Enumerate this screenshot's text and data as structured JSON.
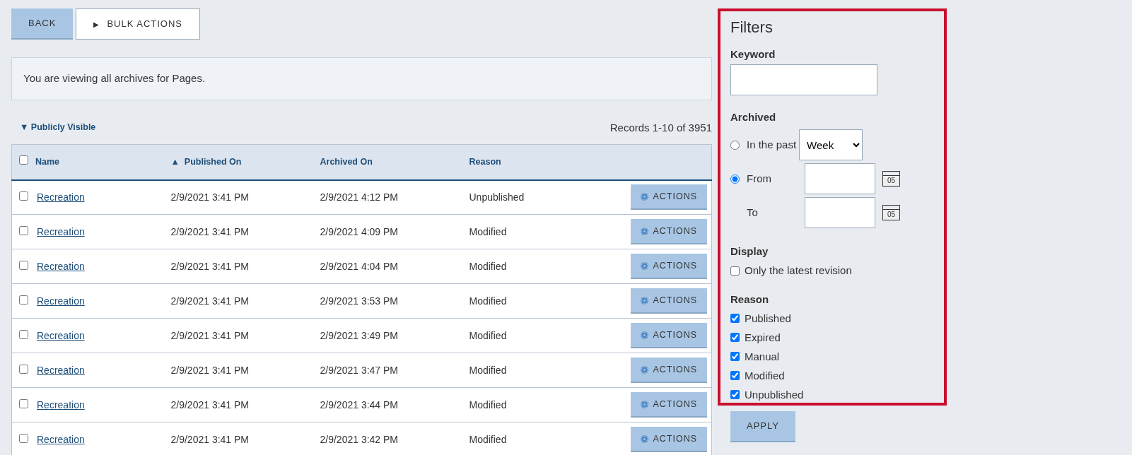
{
  "toolbar": {
    "buttons": [
      {
        "label": "BACK",
        "kind": "primary"
      },
      {
        "label": "BULK ACTIONS",
        "kind": "outline",
        "icon_text": "▶"
      }
    ]
  },
  "notice": "You are viewing all archives for Pages.",
  "group_toggle": {
    "icon_text": "▼",
    "label": "Publicly Visible"
  },
  "records": "Records 1-10 of 3951",
  "table": {
    "select_all_checked": false,
    "columns": [
      {
        "label": "Name"
      },
      {
        "label": "Published On",
        "sort_icon": "▲"
      },
      {
        "label": "Archived On"
      },
      {
        "label": "Reason"
      }
    ],
    "rows": [
      {
        "checked": false,
        "name": "Recreation",
        "published_on": "2/9/2021 3:41 PM",
        "archived_on": "2/9/2021 4:12 PM",
        "reason": "Unpublished",
        "action": "ACTIONS"
      },
      {
        "checked": false,
        "name": "Recreation",
        "published_on": "2/9/2021 3:41 PM",
        "archived_on": "2/9/2021 4:09 PM",
        "reason": "Modified",
        "action": "ACTIONS"
      },
      {
        "checked": false,
        "name": "Recreation",
        "published_on": "2/9/2021 3:41 PM",
        "archived_on": "2/9/2021 4:04 PM",
        "reason": "Modified",
        "action": "ACTIONS"
      },
      {
        "checked": false,
        "name": "Recreation",
        "published_on": "2/9/2021 3:41 PM",
        "archived_on": "2/9/2021 3:53 PM",
        "reason": "Modified",
        "action": "ACTIONS"
      },
      {
        "checked": false,
        "name": "Recreation",
        "published_on": "2/9/2021 3:41 PM",
        "archived_on": "2/9/2021 3:49 PM",
        "reason": "Modified",
        "action": "ACTIONS"
      },
      {
        "checked": false,
        "name": "Recreation",
        "published_on": "2/9/2021 3:41 PM",
        "archived_on": "2/9/2021 3:47 PM",
        "reason": "Modified",
        "action": "ACTIONS"
      },
      {
        "checked": false,
        "name": "Recreation",
        "published_on": "2/9/2021 3:41 PM",
        "archived_on": "2/9/2021 3:44 PM",
        "reason": "Modified",
        "action": "ACTIONS"
      },
      {
        "checked": false,
        "name": "Recreation",
        "published_on": "2/9/2021 3:41 PM",
        "archived_on": "2/9/2021 3:42 PM",
        "reason": "Modified",
        "action": "ACTIONS"
      }
    ]
  },
  "filters": {
    "title": "Filters",
    "keyword": {
      "label": "Keyword"
    },
    "archived": {
      "label": "Archived",
      "options": [
        {
          "kind": "select",
          "label": "In the past",
          "selected": false,
          "value": "Week"
        },
        {
          "kind": "date",
          "label": "From",
          "selected": true,
          "icon_text": "05"
        },
        {
          "kind": "date_plain",
          "label": "To",
          "icon_text": "05"
        }
      ]
    },
    "display": {
      "label": "Display",
      "options": [
        {
          "label": "Only the latest revision",
          "checked": false
        }
      ]
    },
    "reason": {
      "label": "Reason",
      "options": [
        {
          "label": "Published",
          "checked": true
        },
        {
          "label": "Expired",
          "checked": true
        },
        {
          "label": "Manual",
          "checked": true
        },
        {
          "label": "Modified",
          "checked": true
        },
        {
          "label": "Unpublished",
          "checked": true
        }
      ]
    }
  },
  "apply": "APPLY"
}
